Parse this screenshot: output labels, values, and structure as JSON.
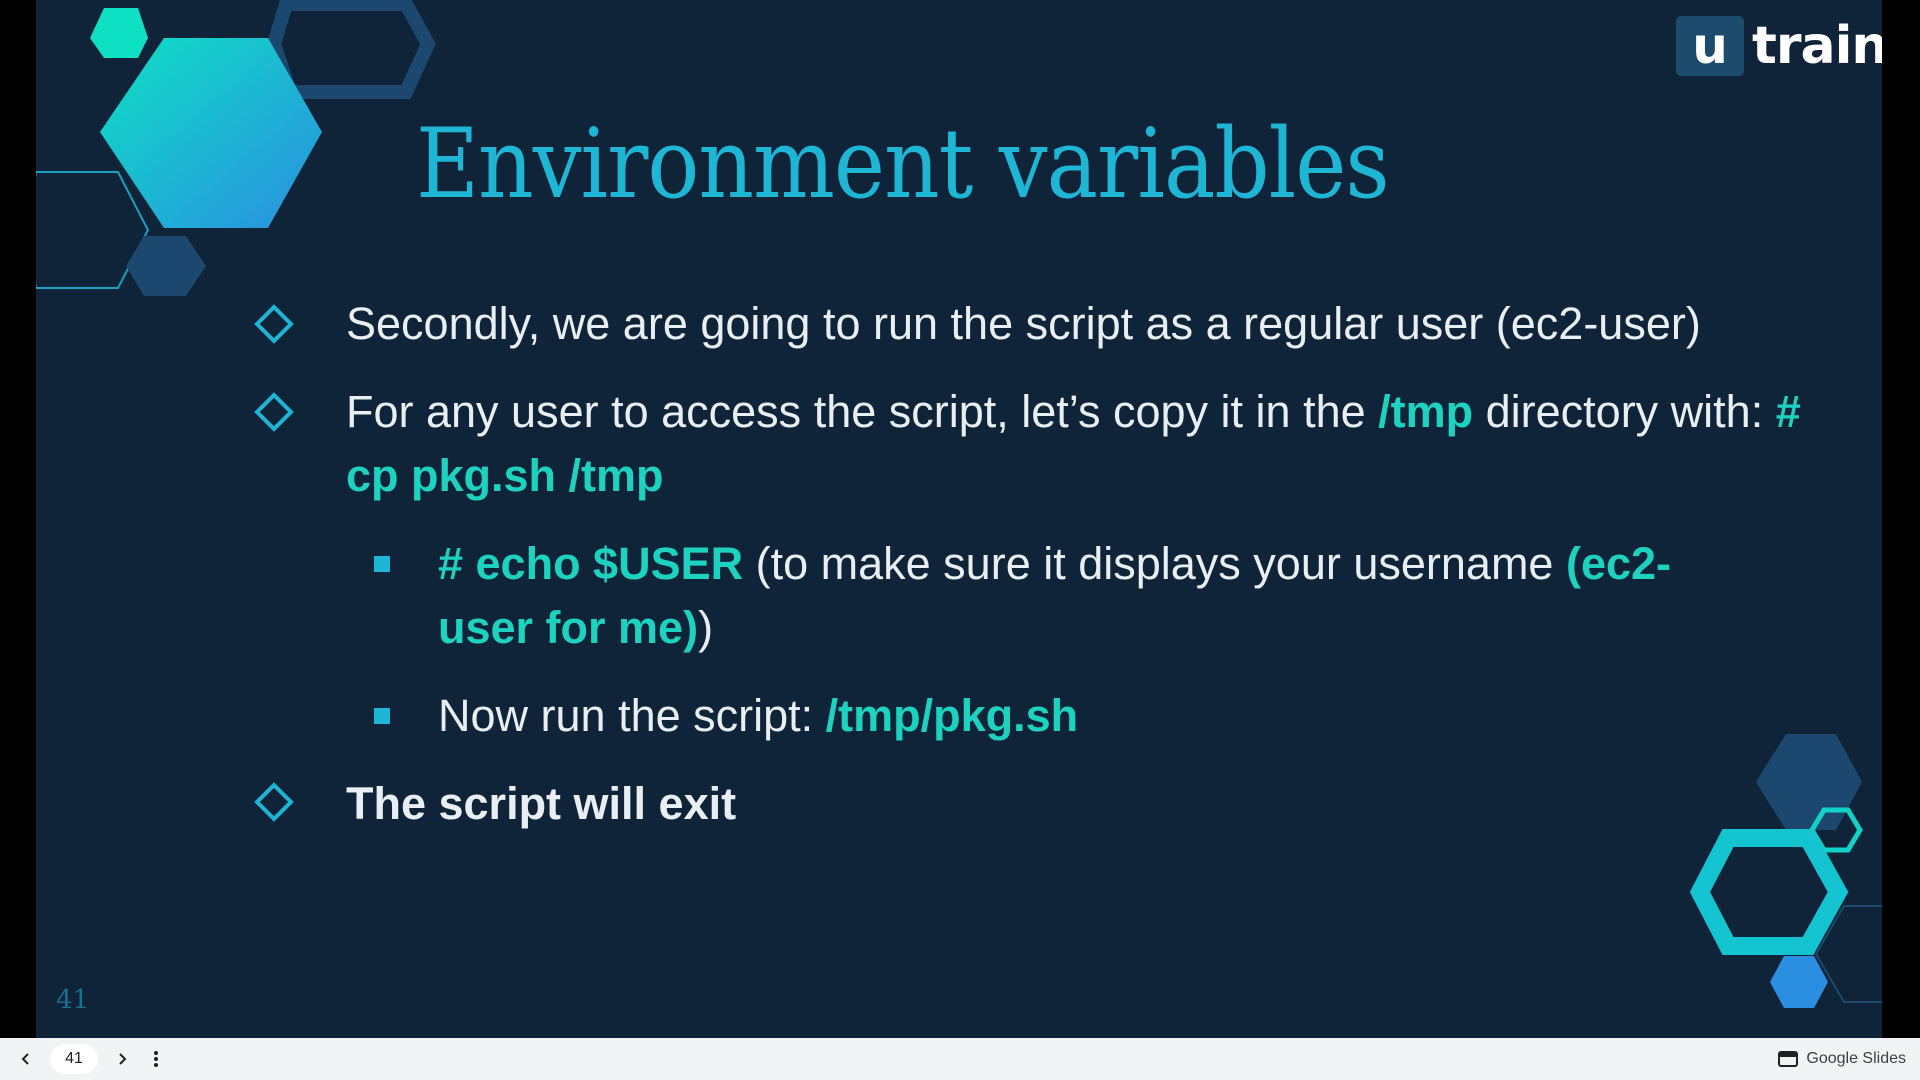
{
  "slide": {
    "title": "Environment variables",
    "brand": {
      "mark": "u",
      "word": "train"
    },
    "bullets": [
      {
        "text": "Secondly, we are going to run the script as a regular user (ec2-user)"
      },
      {
        "pre": "For any user to access the script, let’s copy it in the ",
        "hl1": "/tmp",
        "mid": " directory with: ",
        "hl2": "# cp pkg.sh /tmp"
      },
      {
        "hl1": "# echo $USER",
        "mid": "  (to make sure it displays your username ",
        "hl2": "(ec2-user for me)",
        "post": ")"
      },
      {
        "pre": "Now run the script: ",
        "hl1": "/tmp/pkg.sh"
      },
      {
        "text": "The script will exit"
      }
    ],
    "page_mark": "41"
  },
  "toolbar": {
    "page_value": "41",
    "brand_label": "Google Slides"
  },
  "icons": [
    "chevron-left-icon",
    "chevron-right-icon",
    "more-vert-icon",
    "slides-icon"
  ],
  "colors": {
    "background": "#0f2438",
    "title": "#1fb6d6",
    "highlight": "#1ed2c0",
    "text": "#e9eef3"
  }
}
